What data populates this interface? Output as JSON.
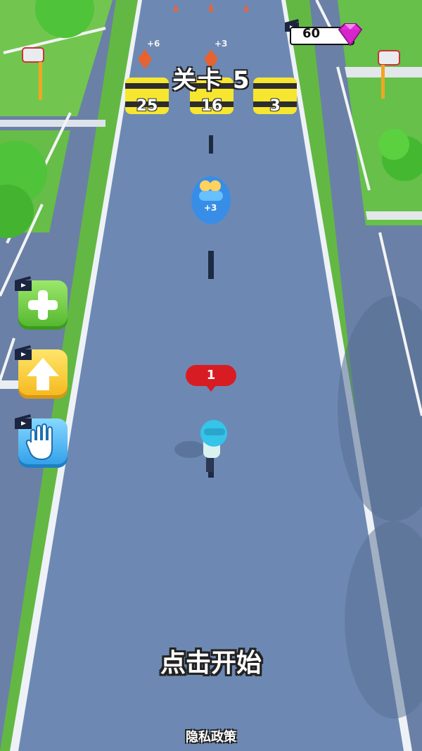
{
  "level": {
    "title": "关卡 5"
  },
  "gems": {
    "count": "60"
  },
  "barrels": [
    {
      "value": "25",
      "bonus": "+6"
    },
    {
      "value": "16",
      "bonus": "+3"
    },
    {
      "value": "3",
      "bonus": ""
    }
  ],
  "pickup": {
    "label": "+3"
  },
  "player": {
    "count": "1"
  },
  "controls": {
    "add_icon": "plus-icon",
    "jump_icon": "arrow-up-icon",
    "stop_icon": "hand-icon",
    "video_icon": "video-clapper-icon"
  },
  "prompt": {
    "start": "点击开始"
  },
  "footer": {
    "privacy": "隐私政策"
  },
  "colors": {
    "road": "#6d89b3",
    "grass": "#6cc44a",
    "accent_gem": "#e22fd5",
    "bubble": "#d71d23"
  }
}
